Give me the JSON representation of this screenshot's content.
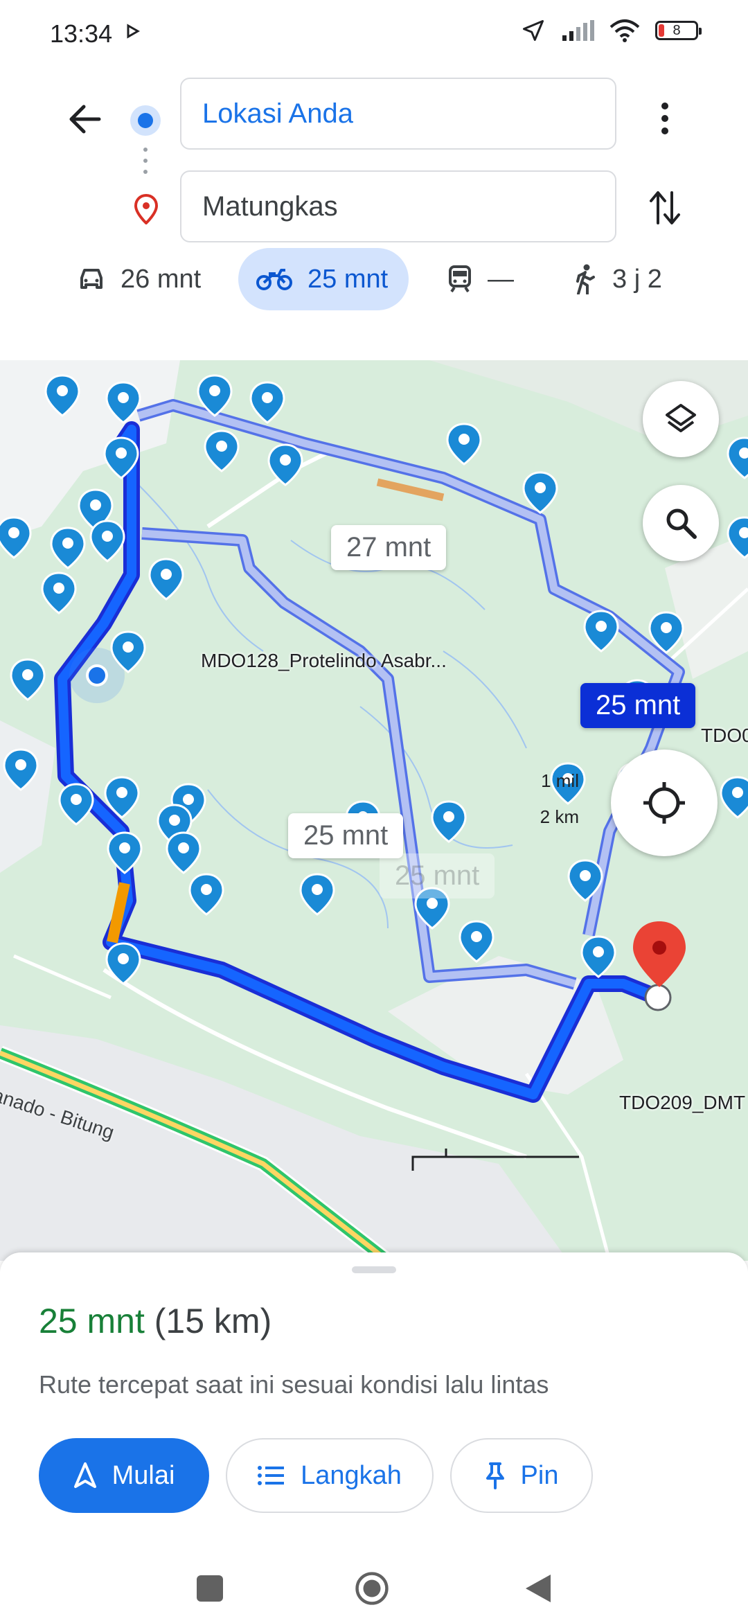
{
  "status_bar": {
    "time": "13:34",
    "battery": "8"
  },
  "header": {
    "origin_value": "Lokasi Anda",
    "destination_value": "Matungkas",
    "modes": [
      {
        "name": "car",
        "label": "26 mnt",
        "selected": false
      },
      {
        "name": "motorcycle",
        "label": "25 mnt",
        "selected": true
      },
      {
        "name": "transit",
        "label": "—",
        "selected": false
      },
      {
        "name": "walk",
        "label": "3 j 2",
        "selected": false
      }
    ]
  },
  "map": {
    "route_labels": [
      "27 mnt",
      "25 mnt",
      "25 mnt",
      "25 mnt"
    ],
    "poi_labels": [
      "MDO128_Protelindo Asabr...",
      "TDO0",
      "TDO209_DMT"
    ],
    "road_label": "anado - Bitung",
    "scale": {
      "imperial": "1 mil",
      "metric": "2 km"
    }
  },
  "sheet": {
    "duration": "25 mnt",
    "distance": "(15 km)",
    "description": "Rute tercepat saat ini sesuai kondisi lalu lintas",
    "buttons": {
      "start": "Mulai",
      "steps": "Langkah",
      "pin": "Pin"
    }
  },
  "colors": {
    "accent": "#1a73e8",
    "route_active": "#0b2fd6",
    "route_alt": "#a8b6f0",
    "map_bg": "#d8eddc",
    "time_green": "#188038"
  }
}
